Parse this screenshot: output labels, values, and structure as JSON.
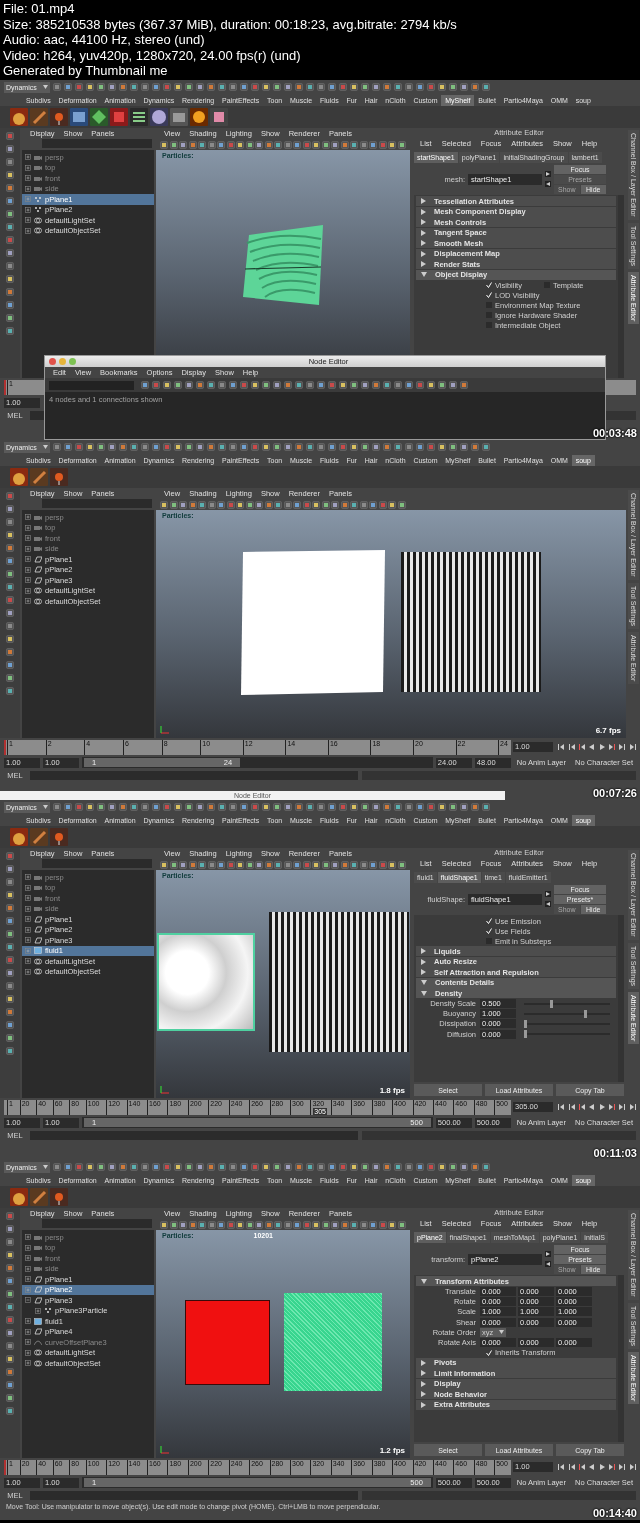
{
  "header": {
    "lines": [
      "File: 01.mp4",
      "Size: 385210538 bytes (367.37 MiB), duration: 00:18:23, avg.bitrate: 2794 kb/s",
      "Audio: aac, 44100 Hz, stereo (und)",
      "Video: h264, yuv420p, 1280x720, 24.00 fps(r) (und)",
      "Generated by Thumbnail me"
    ]
  },
  "frames": [
    {
      "timestamp": "00:03:48",
      "mode": "Dynamics",
      "shelf_tabs": [
        {
          "label": "Subdivs",
          "selected": false
        },
        {
          "label": "Deformation",
          "selected": false
        },
        {
          "label": "Animation",
          "selected": false
        },
        {
          "label": "Dynamics",
          "selected": false
        },
        {
          "label": "Rendering",
          "selected": false
        },
        {
          "label": "PaintEffects",
          "selected": false
        },
        {
          "label": "Toon",
          "selected": false
        },
        {
          "label": "Muscle",
          "selected": false
        },
        {
          "label": "Fluids",
          "selected": false
        },
        {
          "label": "Fur",
          "selected": false
        },
        {
          "label": "Hair",
          "selected": false
        },
        {
          "label": "nCloth",
          "selected": false
        },
        {
          "label": "Custom",
          "selected": false
        },
        {
          "label": "MyShelf",
          "selected": true
        },
        {
          "label": "Bullet",
          "selected": false
        },
        {
          "label": "Partio4Maya",
          "selected": false
        },
        {
          "label": "OMM",
          "selected": false
        },
        {
          "label": "soup",
          "selected": false
        }
      ],
      "shelf_icons": [
        {
          "kind": "soup"
        },
        {
          "kind": "wrench"
        },
        {
          "kind": "plug"
        },
        {
          "kind": "lam"
        },
        {
          "kind": "diamond"
        },
        {
          "kind": "render"
        },
        {
          "kind": "list"
        },
        {
          "kind": "sphere"
        },
        {
          "kind": "export"
        },
        {
          "kind": "fire"
        },
        {
          "kind": "cube"
        }
      ],
      "outliner": {
        "menu": [
          "Display",
          "Show",
          "Panels"
        ],
        "items": [
          {
            "label": "persp",
            "kind": "camera",
            "dimmed": true,
            "selected": false,
            "expanded": false
          },
          {
            "label": "top",
            "kind": "camera",
            "dimmed": true,
            "selected": false,
            "expanded": false
          },
          {
            "label": "front",
            "kind": "camera",
            "dimmed": true,
            "selected": false,
            "expanded": false
          },
          {
            "label": "side",
            "kind": "camera",
            "dimmed": true,
            "selected": false,
            "expanded": false
          },
          {
            "label": "pPlane1",
            "kind": "particle",
            "dimmed": false,
            "selected": true,
            "expanded": false
          },
          {
            "label": "pPlane2",
            "kind": "particle",
            "dimmed": false,
            "selected": false,
            "expanded": false
          },
          {
            "label": "defaultLightSet",
            "kind": "set",
            "dimmed": false,
            "selected": false,
            "expanded": false
          },
          {
            "label": "defaultObjectSet",
            "kind": "set",
            "dimmed": false,
            "selected": false,
            "expanded": false
          }
        ]
      },
      "viewport": {
        "menu": [
          "View",
          "Shading",
          "Lighting",
          "Show",
          "Renderer",
          "Panels"
        ],
        "label": "Particles:",
        "objects": [
          {
            "kind": "wavy-plane"
          }
        ]
      },
      "attribute_editor": {
        "title": "Attribute Editor",
        "menu": [
          "List",
          "Selected",
          "Focus",
          "Attributes",
          "Show",
          "Help"
        ],
        "tabs": [
          {
            "label": "startShape1",
            "selected": true
          },
          {
            "label": "polyPlane1",
            "selected": false
          },
          {
            "label": "initialShadingGroup",
            "selected": false
          },
          {
            "label": "lambert1",
            "selected": false
          }
        ],
        "node_label": "mesh:",
        "node_value": "startShape1",
        "buttons": [
          {
            "label": "Focus",
            "disabled": false
          },
          {
            "label": "Presets",
            "disabled": true
          },
          {
            "label": "Show",
            "disabled": true
          },
          {
            "label": "Hide",
            "disabled": false
          }
        ],
        "rows": [
          {
            "kind": "section",
            "label": "Tessellation Attributes",
            "expanded": false
          },
          {
            "kind": "section",
            "label": "Mesh Component Display",
            "expanded": false
          },
          {
            "kind": "section",
            "label": "Mesh Controls",
            "expanded": false
          },
          {
            "kind": "section",
            "label": "Tangent Space",
            "expanded": false
          },
          {
            "kind": "section",
            "label": "Smooth Mesh",
            "expanded": false
          },
          {
            "kind": "section",
            "label": "Displacement Map",
            "expanded": false
          },
          {
            "kind": "section",
            "label": "Render Stats",
            "expanded": false
          },
          {
            "kind": "section",
            "label": "Object Display",
            "expanded": true
          },
          {
            "kind": "checkbox",
            "label": "Visibility",
            "checked": true,
            "extra": {
              "label": "Template",
              "checked": false
            }
          },
          {
            "kind": "checkbox",
            "label": "LOD Visibility",
            "checked": true
          },
          {
            "kind": "checkbox",
            "label": "Environment Map Texture",
            "checked": false
          },
          {
            "kind": "checkbox",
            "label": "Ignore Hardware Shader",
            "checked": false
          },
          {
            "kind": "checkbox",
            "label": "Intermediate Object",
            "checked": false
          }
        ]
      },
      "side_tabs": [
        {
          "label": "Channel Box / Layer Editor",
          "selected": false
        },
        {
          "label": "Tool Settings",
          "selected": false
        },
        {
          "label": "Attribute Editor",
          "selected": true
        }
      ],
      "timeline": {
        "ticks": [
          "1"
        ],
        "level": 0
      },
      "range": {
        "start": "1.00"
      },
      "command_line": {
        "label": "MEL"
      },
      "node_editor": {
        "title": "Node Editor",
        "menu": [
          "Edit",
          "View",
          "Bookmarks",
          "Options",
          "Display",
          "Show",
          "Help"
        ],
        "status": "4 nodes and 1 connections shown"
      }
    },
    {
      "timestamp": "00:07:26",
      "mode": "Dynamics",
      "shelf_tabs": [
        {
          "label": "Subdivs",
          "selected": false
        },
        {
          "label": "Deformation",
          "selected": false
        },
        {
          "label": "Animation",
          "selected": false
        },
        {
          "label": "Dynamics",
          "selected": false
        },
        {
          "label": "Rendering",
          "selected": false
        },
        {
          "label": "PaintEffects",
          "selected": false
        },
        {
          "label": "Toon",
          "selected": false
        },
        {
          "label": "Muscle",
          "selected": false
        },
        {
          "label": "Fluids",
          "selected": false
        },
        {
          "label": "Fur",
          "selected": false
        },
        {
          "label": "Hair",
          "selected": false
        },
        {
          "label": "nCloth",
          "selected": false
        },
        {
          "label": "Custom",
          "selected": false
        },
        {
          "label": "MyShelf",
          "selected": false
        },
        {
          "label": "Bullet",
          "selected": false
        },
        {
          "label": "Partio4Maya",
          "selected": false
        },
        {
          "label": "OMM",
          "selected": false
        },
        {
          "label": "soup",
          "selected": true
        }
      ],
      "shelf_icons": [
        {
          "kind": "soup"
        },
        {
          "kind": "wrench"
        },
        {
          "kind": "plug"
        }
      ],
      "outliner": {
        "menu": [
          "Display",
          "Show",
          "Panels"
        ],
        "items": [
          {
            "label": "persp",
            "kind": "camera",
            "dimmed": true,
            "selected": false,
            "expanded": false
          },
          {
            "label": "top",
            "kind": "camera",
            "dimmed": true,
            "selected": false,
            "expanded": false
          },
          {
            "label": "front",
            "kind": "camera",
            "dimmed": true,
            "selected": false,
            "expanded": false
          },
          {
            "label": "side",
            "kind": "camera",
            "dimmed": true,
            "selected": false,
            "expanded": false
          },
          {
            "label": "pPlane1",
            "kind": "mesh",
            "dimmed": false,
            "selected": false,
            "expanded": false
          },
          {
            "label": "pPlane2",
            "kind": "mesh",
            "dimmed": false,
            "selected": false,
            "expanded": false
          },
          {
            "label": "pPlane3",
            "kind": "mesh",
            "dimmed": false,
            "selected": false,
            "expanded": false
          },
          {
            "label": "defaultLightSet",
            "kind": "set",
            "dimmed": false,
            "selected": false,
            "expanded": false
          },
          {
            "label": "defaultObjectSet",
            "kind": "set",
            "dimmed": false,
            "selected": false,
            "expanded": false
          }
        ]
      },
      "viewport": {
        "menu": [
          "View",
          "Shading",
          "Lighting",
          "Show",
          "Renderer",
          "Panels"
        ],
        "label": "Particles:",
        "fps": "6.7 fps",
        "objects": [
          {
            "kind": "white-plane"
          },
          {
            "kind": "weave"
          }
        ]
      },
      "side_tabs": [
        {
          "label": "Channel Box / Layer Editor",
          "selected": false
        },
        {
          "label": "Tool Settings",
          "selected": false
        },
        {
          "label": "Attribute Editor",
          "selected": false
        }
      ],
      "timeline": {
        "ticks": [
          "1",
          "2",
          "4",
          "6",
          "8",
          "10",
          "12",
          "14",
          "16",
          "18",
          "20",
          "22",
          "24"
        ],
        "current": "1.00",
        "level": 0
      },
      "range": {
        "start": "1.00",
        "inner_start": "1.00",
        "bar_start": "1",
        "bar_end": "24",
        "level": 0.45,
        "inner_end": "24.00",
        "end": "48.00",
        "anim_layer": "No Anim Layer",
        "character_set": "No Character Set"
      },
      "command_line": {
        "label": "MEL"
      },
      "partial_window": {
        "title": "Node Editor"
      }
    },
    {
      "timestamp": "00:11:03",
      "mode": "Dynamics",
      "shelf_tabs": [
        {
          "label": "Subdivs",
          "selected": false
        },
        {
          "label": "Deformation",
          "selected": false
        },
        {
          "label": "Animation",
          "selected": false
        },
        {
          "label": "Dynamics",
          "selected": false
        },
        {
          "label": "Rendering",
          "selected": false
        },
        {
          "label": "PaintEffects",
          "selected": false
        },
        {
          "label": "Toon",
          "selected": false
        },
        {
          "label": "Muscle",
          "selected": false
        },
        {
          "label": "Fluids",
          "selected": false
        },
        {
          "label": "Fur",
          "selected": false
        },
        {
          "label": "Hair",
          "selected": false
        },
        {
          "label": "nCloth",
          "selected": false
        },
        {
          "label": "Custom",
          "selected": false
        },
        {
          "label": "MyShelf",
          "selected": false
        },
        {
          "label": "Bullet",
          "selected": false
        },
        {
          "label": "Partio4Maya",
          "selected": false
        },
        {
          "label": "OMM",
          "selected": false
        },
        {
          "label": "soup",
          "selected": true
        }
      ],
      "shelf_icons": [
        {
          "kind": "soup"
        },
        {
          "kind": "wrench"
        },
        {
          "kind": "plug"
        }
      ],
      "outliner": {
        "menu": [
          "Display",
          "Show",
          "Panels"
        ],
        "items": [
          {
            "label": "persp",
            "kind": "camera",
            "dimmed": true,
            "selected": false,
            "expanded": false
          },
          {
            "label": "top",
            "kind": "camera",
            "dimmed": true,
            "selected": false,
            "expanded": false
          },
          {
            "label": "front",
            "kind": "camera",
            "dimmed": true,
            "selected": false,
            "expanded": false
          },
          {
            "label": "side",
            "kind": "camera",
            "dimmed": true,
            "selected": false,
            "expanded": false
          },
          {
            "label": "pPlane1",
            "kind": "mesh",
            "dimmed": false,
            "selected": false,
            "expanded": false
          },
          {
            "label": "pPlane2",
            "kind": "mesh",
            "dimmed": false,
            "selected": false,
            "expanded": false
          },
          {
            "label": "pPlane3",
            "kind": "mesh",
            "dimmed": false,
            "selected": false,
            "expanded": false
          },
          {
            "label": "fluid1",
            "kind": "fluid",
            "dimmed": false,
            "selected": true,
            "expanded": false
          },
          {
            "label": "defaultLightSet",
            "kind": "set",
            "dimmed": false,
            "selected": false,
            "expanded": false
          },
          {
            "label": "defaultObjectSet",
            "kind": "set",
            "dimmed": false,
            "selected": false,
            "expanded": false
          }
        ]
      },
      "viewport": {
        "menu": [
          "View",
          "Shading",
          "Lighting",
          "Show",
          "Renderer",
          "Panels"
        ],
        "label": "Particles:",
        "fps": "1.8 fps",
        "objects": [
          {
            "kind": "fluid"
          },
          {
            "kind": "weave"
          }
        ]
      },
      "attribute_editor": {
        "title": "Attribute Editor",
        "menu": [
          "List",
          "Selected",
          "Focus",
          "Attributes",
          "Show",
          "Help"
        ],
        "tabs": [
          {
            "label": "fluid1",
            "selected": false
          },
          {
            "label": "fluidShape1",
            "selected": true
          },
          {
            "label": "time1",
            "selected": false
          },
          {
            "label": "fluidEmitter1",
            "selected": false
          }
        ],
        "node_label": "fluidShape:",
        "node_value": "fluidShape1",
        "buttons": [
          {
            "label": "Focus",
            "disabled": false
          },
          {
            "label": "Presets*",
            "disabled": false
          },
          {
            "label": "Show",
            "disabled": true
          },
          {
            "label": "Hide",
            "disabled": false
          }
        ],
        "rows": [
          {
            "kind": "checkbox",
            "label": "Use Emission",
            "checked": true
          },
          {
            "kind": "checkbox",
            "label": "Use Fields",
            "checked": true
          },
          {
            "kind": "checkbox",
            "label": "Emit in Substeps",
            "checked": false
          },
          {
            "kind": "section",
            "label": "Liquids",
            "expanded": false
          },
          {
            "kind": "section",
            "label": "Auto Resize",
            "expanded": false
          },
          {
            "kind": "section",
            "label": "Self Attraction and Repulsion",
            "expanded": false
          },
          {
            "kind": "section",
            "label": "Contents Details",
            "expanded": true
          },
          {
            "kind": "section",
            "label": "Density",
            "expanded": true
          },
          {
            "kind": "slider",
            "label": "Density Scale",
            "value": "0.500",
            "level": 0.3
          },
          {
            "kind": "slider",
            "label": "Buoyancy",
            "value": "1.000",
            "level": 0.7
          },
          {
            "kind": "slider",
            "label": "Dissipation",
            "value": "0.000",
            "level": 0
          },
          {
            "kind": "slider",
            "label": "Diffusion",
            "value": "0.000",
            "level": 0
          }
        ],
        "bottom_buttons": [
          "Select",
          "Load Attributes",
          "Copy Tab"
        ]
      },
      "side_tabs": [
        {
          "label": "Channel Box / Layer Editor",
          "selected": false
        },
        {
          "label": "Tool Settings",
          "selected": false
        },
        {
          "label": "Attribute Editor",
          "selected": true
        }
      ],
      "timeline": {
        "ticks": [
          "1",
          "20",
          "40",
          "60",
          "80",
          "100",
          "120",
          "140",
          "160",
          "180",
          "200",
          "220",
          "240",
          "260",
          "280",
          "300",
          "320",
          "340",
          "360",
          "380",
          "400",
          "420",
          "440",
          "460",
          "480",
          "500"
        ],
        "current": "305.00",
        "marker": "305",
        "level": 0.61
      },
      "range": {
        "start": "1.00",
        "inner_start": "1.00",
        "level": 1,
        "bar_start": "1",
        "bar_end": "500",
        "inner_end": "500.00",
        "end": "500.00",
        "anim_layer": "No Anim Layer",
        "character_set": "No Character Set"
      },
      "command_line": {
        "label": "MEL"
      }
    },
    {
      "timestamp": "00:14:40",
      "mode": "Dynamics",
      "shelf_tabs": [
        {
          "label": "Subdivs",
          "selected": false
        },
        {
          "label": "Deformation",
          "selected": false
        },
        {
          "label": "Animation",
          "selected": false
        },
        {
          "label": "Dynamics",
          "selected": false
        },
        {
          "label": "Rendering",
          "selected": false
        },
        {
          "label": "PaintEffects",
          "selected": false
        },
        {
          "label": "Toon",
          "selected": false
        },
        {
          "label": "Muscle",
          "selected": false
        },
        {
          "label": "Fluids",
          "selected": false
        },
        {
          "label": "Fur",
          "selected": false
        },
        {
          "label": "Hair",
          "selected": false
        },
        {
          "label": "nCloth",
          "selected": false
        },
        {
          "label": "Custom",
          "selected": false
        },
        {
          "label": "MyShelf",
          "selected": false
        },
        {
          "label": "Bullet",
          "selected": false
        },
        {
          "label": "Partio4Maya",
          "selected": false
        },
        {
          "label": "OMM",
          "selected": false
        },
        {
          "label": "soup",
          "selected": true
        }
      ],
      "shelf_icons": [
        {
          "kind": "soup"
        },
        {
          "kind": "wrench"
        },
        {
          "kind": "plug"
        }
      ],
      "outliner": {
        "menu": [
          "Display",
          "Show",
          "Panels"
        ],
        "items": [
          {
            "label": "persp",
            "kind": "camera",
            "dimmed": true,
            "selected": false,
            "expanded": false
          },
          {
            "label": "top",
            "kind": "camera",
            "dimmed": true,
            "selected": false,
            "expanded": false
          },
          {
            "label": "front",
            "kind": "camera",
            "dimmed": true,
            "selected": false,
            "expanded": false
          },
          {
            "label": "side",
            "kind": "camera",
            "dimmed": true,
            "selected": false,
            "expanded": false
          },
          {
            "label": "pPlane1",
            "kind": "mesh",
            "dimmed": false,
            "selected": false,
            "expanded": false
          },
          {
            "label": "pPlane2",
            "kind": "mesh",
            "dimmed": false,
            "selected": true,
            "expanded": false
          },
          {
            "label": "pPlane3",
            "kind": "mesh",
            "dimmed": false,
            "selected": false,
            "expanded": true,
            "children": [
              {
                "label": "pPlane3Particle",
                "kind": "particle",
                "dimmed": false,
                "selected": false,
                "expanded": false
              }
            ]
          },
          {
            "label": "fluid1",
            "kind": "fluid",
            "dimmed": false,
            "selected": false,
            "expanded": false
          },
          {
            "label": "pPlane4",
            "kind": "mesh",
            "dimmed": false,
            "selected": false,
            "expanded": false
          },
          {
            "label": "curveOffsetPlane3",
            "kind": "curve",
            "dimmed": true,
            "selected": false,
            "expanded": false
          },
          {
            "label": "defaultLightSet",
            "kind": "set",
            "dimmed": false,
            "selected": false,
            "expanded": false
          },
          {
            "label": "defaultObjectSet",
            "kind": "set",
            "dimmed": false,
            "selected": false,
            "expanded": false
          }
        ]
      },
      "viewport": {
        "menu": [
          "View",
          "Shading",
          "Lighting",
          "Show",
          "Renderer",
          "Panels"
        ],
        "label": "Particles:",
        "counter": "10201",
        "fps": "1.2 fps",
        "objects": [
          {
            "kind": "red-plane"
          },
          {
            "kind": "green-pattern"
          }
        ]
      },
      "attribute_editor": {
        "title": "Attribute Editor",
        "menu": [
          "List",
          "Selected",
          "Focus",
          "Attributes",
          "Show",
          "Help"
        ],
        "tabs": [
          {
            "label": "pPlane2",
            "selected": true
          },
          {
            "label": "finalShape1",
            "selected": false
          },
          {
            "label": "meshToMap1",
            "selected": false
          },
          {
            "label": "polyPlane1",
            "selected": false
          },
          {
            "label": "initialS",
            "selected": false
          }
        ],
        "node_label": "transform:",
        "node_value": "pPlane2",
        "buttons": [
          {
            "label": "Focus",
            "disabled": false
          },
          {
            "label": "Presets",
            "disabled": false
          },
          {
            "label": "Show",
            "disabled": true
          },
          {
            "label": "Hide",
            "disabled": false
          }
        ],
        "rows": [
          {
            "kind": "section",
            "label": "Transform Attributes",
            "expanded": true
          },
          {
            "kind": "vector",
            "label": "Translate",
            "values": [
              "0.000",
              "0.000",
              "0.000"
            ]
          },
          {
            "kind": "vector",
            "label": "Rotate",
            "values": [
              "0.000",
              "0.000",
              "0.000"
            ]
          },
          {
            "kind": "vector",
            "label": "Scale",
            "values": [
              "1.000",
              "1.000",
              "1.000"
            ]
          },
          {
            "kind": "vector",
            "label": "Shear",
            "values": [
              "0.000",
              "0.000",
              "0.000"
            ]
          },
          {
            "kind": "dropdown",
            "label": "Rotate Order",
            "value": "xyz"
          },
          {
            "kind": "vector",
            "label": "Rotate Axis",
            "values": [
              "0.000",
              "0.000",
              "0.000"
            ]
          },
          {
            "kind": "checkbox",
            "label": "Inherits Transform",
            "checked": true
          },
          {
            "kind": "section",
            "label": "Pivots",
            "expanded": false
          },
          {
            "kind": "section",
            "label": "Limit Information",
            "expanded": false
          },
          {
            "kind": "section",
            "label": "Display",
            "expanded": false
          },
          {
            "kind": "section",
            "label": "Node Behavior",
            "expanded": false
          },
          {
            "kind": "section",
            "label": "Extra Attributes",
            "expanded": false
          }
        ],
        "bottom_buttons": [
          "Select",
          "Load Attributes",
          "Copy Tab"
        ]
      },
      "side_tabs": [
        {
          "label": "Channel Box / Layer Editor",
          "selected": false
        },
        {
          "label": "Tool Settings",
          "selected": false
        },
        {
          "label": "Attribute Editor",
          "selected": true
        }
      ],
      "timeline": {
        "ticks": [
          "1",
          "20",
          "40",
          "60",
          "80",
          "100",
          "120",
          "140",
          "160",
          "180",
          "200",
          "220",
          "240",
          "260",
          "280",
          "300",
          "320",
          "340",
          "360",
          "380",
          "400",
          "420",
          "440",
          "460",
          "480",
          "500"
        ],
        "current": "1.00",
        "level": 0
      },
      "range": {
        "start": "1.00",
        "level": 1,
        "inner_start": "1.00",
        "bar_start": "1",
        "bar_end": "500",
        "inner_end": "500.00",
        "end": "500.00",
        "anim_layer": "No Anim Layer",
        "character_set": "No Character Set"
      },
      "command_line": {
        "label": "MEL"
      },
      "help_line": "Move Tool: Use manipulator to move object(s). Use edit mode to change pivot (HOME). Ctrl+LMB to move perpendicular."
    }
  ]
}
